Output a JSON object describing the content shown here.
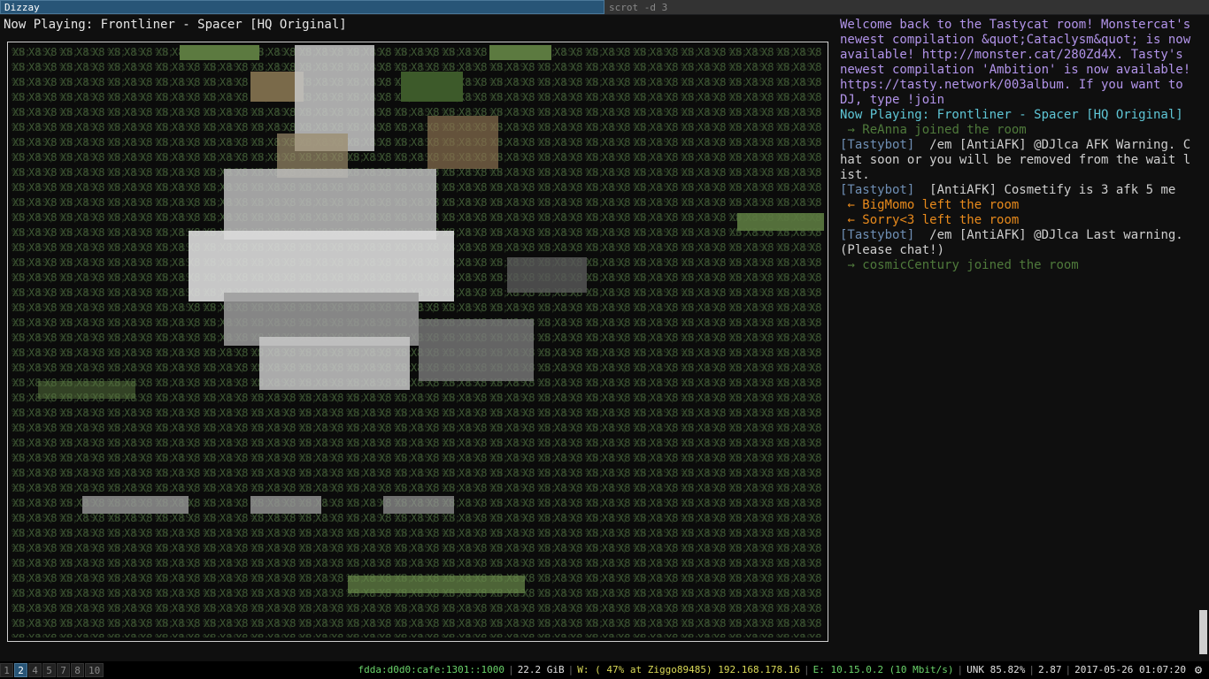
{
  "titlebar": {
    "tabs": [
      {
        "label": "Dizzay",
        "active": true
      },
      {
        "label": "scrot -d 3",
        "active": false
      }
    ]
  },
  "player": {
    "now_playing": "Now Playing: Frontliner - Spacer [HQ Original]"
  },
  "chat": {
    "lines": [
      {
        "type": "welcome",
        "text": "Welcome back to the Tastycat room! Monstercat's newest compilation &quot;Cataclysm&quot; is now available! http://monster.cat/280Zd4X. Tasty's newest compilation 'Ambition' is now available! https://tasty.network/003album. If you want to DJ, type !join"
      },
      {
        "type": "np",
        "text": "Now Playing: Frontliner - Spacer [HQ Original]"
      },
      {
        "type": "join",
        "text": " → ReAnna joined the room"
      },
      {
        "type": "bot",
        "text": "[Tastybot]  /em [AntiAFK] @DJlca AFK Warning. Chat soon or you will be removed from the wait list."
      },
      {
        "type": "bot",
        "text": "[Tastybot]  [AntiAFK] Cosmetify is 3 afk 5 me"
      },
      {
        "type": "left",
        "text": " ← BigMomo left the room"
      },
      {
        "type": "left",
        "text": " ← Sorry<3 left the room"
      },
      {
        "type": "bot",
        "text": "[Tastybot]  /em [AntiAFK] @DJlca Last warning. (Please chat!)"
      },
      {
        "type": "join",
        "text": " → cosmicCentury joined the room"
      }
    ]
  },
  "statusbar": {
    "workspaces": [
      "1",
      "2",
      "4",
      "5",
      "7",
      "8",
      "10"
    ],
    "focused_workspace": "2",
    "ipv6": "fdda:d0d0:cafe:1301::1000",
    "disk": "22.2 GiB",
    "wifi": "W: ( 47% at Ziggo89485) 192.168.178.16",
    "ethernet": "E: 10.15.0.2 (10 Mbit/s)",
    "battery": "UNK 85.82%",
    "load": "2.87",
    "datetime": "2017-05-26 01:07:20",
    "tray_icon": "gear-icon"
  },
  "colors": {
    "accent": "#285577",
    "chat_welcome": "#b294ea",
    "chat_now_playing": "#5fc6d6",
    "chat_join": "#4f7a3b",
    "chat_left": "#e88a1c"
  }
}
